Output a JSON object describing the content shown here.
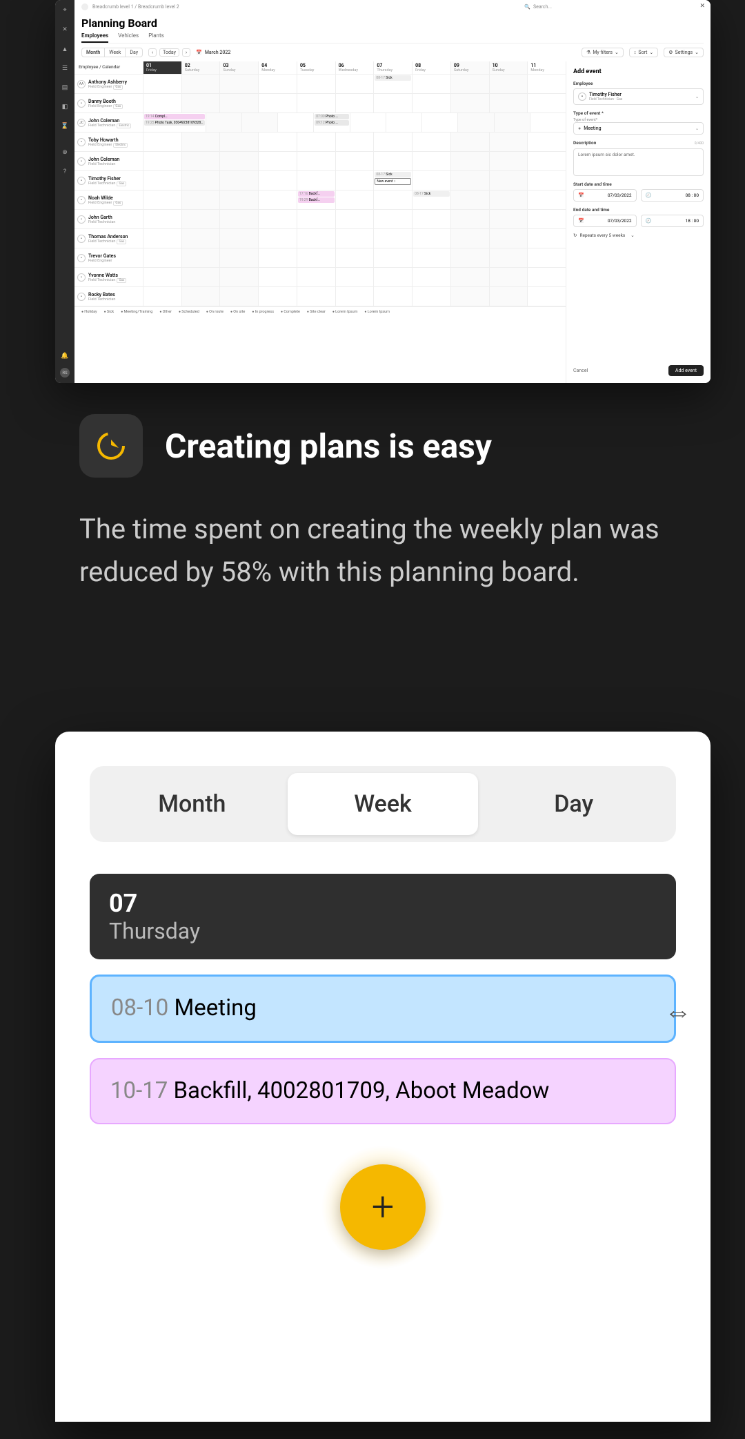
{
  "breadcrumbs": "Breadcrumb level 1 / Breadcrumb level 2",
  "searchPlaceholder": "Search...",
  "pageTitle": "Planning Board",
  "tabs": [
    "Employees",
    "Vehicles",
    "Plants"
  ],
  "activeTab": "Employees",
  "viewSeg": [
    "Month",
    "Week",
    "Day"
  ],
  "topSegActive": "Month",
  "todayLabel": "Today",
  "monthLabel": "March 2022",
  "toolbarRight": {
    "filters": "My filters",
    "sort": "Sort",
    "settings": "Settings"
  },
  "calHeaderLabel": "Employee / Calendar",
  "days": [
    {
      "num": "01",
      "name": "Friday",
      "sel": true
    },
    {
      "num": "02",
      "name": "Saturday",
      "wknd": true
    },
    {
      "num": "03",
      "name": "Sunday",
      "wknd": true
    },
    {
      "num": "04",
      "name": "Monday"
    },
    {
      "num": "05",
      "name": "Tuesday"
    },
    {
      "num": "06",
      "name": "Wednesday"
    },
    {
      "num": "07",
      "name": "Thursday"
    },
    {
      "num": "08",
      "name": "Friday"
    },
    {
      "num": "09",
      "name": "Saturday",
      "wknd": true
    },
    {
      "num": "10",
      "name": "Sunday",
      "wknd": true
    },
    {
      "num": "11",
      "name": "Monday"
    }
  ],
  "employees": [
    {
      "av": "AA",
      "name": "Anthony Ashberry",
      "role": "Field Engineer",
      "tag": "Gas",
      "events": [
        {
          "day": 6,
          "cls": "sick",
          "time": "08-17",
          "label": "Sick"
        }
      ]
    },
    {
      "av": "⚬",
      "name": "Danny Booth",
      "role": "Field Engineer",
      "tag": "Gas",
      "events": []
    },
    {
      "av": "JC",
      "name": "John Coleman",
      "role": "Field Technician",
      "tag": "Electric",
      "events": [
        {
          "day": 0,
          "cls": "pink",
          "time": "19:14",
          "label": "Compl…"
        },
        {
          "day": 0,
          "cls": "photo",
          "time": "19:25",
          "label": "Photo Task, 03049238109328…"
        },
        {
          "day": 4,
          "cls": "photo",
          "time": "07:00",
          "label": "Photo …"
        },
        {
          "day": 4,
          "cls": "photo",
          "time": "09:12",
          "label": "Photo …"
        }
      ]
    },
    {
      "av": "⚬",
      "name": "Toby Howarth",
      "role": "Field Engineer",
      "tag": "Electric",
      "events": []
    },
    {
      "av": "⚬",
      "name": "John Coleman",
      "role": "Field Technician",
      "tag": "",
      "events": []
    },
    {
      "av": "⚬",
      "name": "Timothy Fisher",
      "role": "Field Technician",
      "tag": "Gas",
      "events": [
        {
          "day": 6,
          "cls": "sick",
          "time": "08-17",
          "label": "Sick"
        },
        {
          "day": 6,
          "cls": "sel-box",
          "time": "",
          "label": "New event       ↕"
        }
      ]
    },
    {
      "av": "⚬",
      "name": "Noah Wilde",
      "role": "Field Engineer",
      "tag": "Gas",
      "events": [
        {
          "day": 4,
          "cls": "pink",
          "time": "17:16",
          "label": "Backf…"
        },
        {
          "day": 4,
          "cls": "pink",
          "time": "19:29",
          "label": "Backf…"
        },
        {
          "day": 7,
          "cls": "sick",
          "time": "08-17",
          "label": "Sick"
        }
      ]
    },
    {
      "av": "⚬",
      "name": "John Garth",
      "role": "Field Technician",
      "tag": "",
      "events": []
    },
    {
      "av": "⚬",
      "name": "Thomas Anderson",
      "role": "Field Technician",
      "tag": "Gas",
      "events": []
    },
    {
      "av": "⚬",
      "name": "Trevor Gates",
      "role": "Field Engineer",
      "tag": "",
      "events": []
    },
    {
      "av": "⚬",
      "name": "Yvonne Watts",
      "role": "Field Technician",
      "tag": "Gas",
      "events": []
    },
    {
      "av": "⚬",
      "name": "Rocky Bates",
      "role": "Field Technician",
      "tag": "",
      "events": []
    }
  ],
  "legend": [
    "Holiday",
    "Sick",
    "Meeting/Training",
    "Other",
    "Scheduled",
    "On route",
    "On site",
    "In progress",
    "Complete",
    "Site clear",
    "Lorem Ipsum",
    "Lorem Ipsum"
  ],
  "panel": {
    "title": "Add event",
    "employeeLabel": "Employee",
    "employeeName": "Timothy Fisher",
    "employeeRole": "Field Technician",
    "employeeTag": "Gas",
    "typeLabel": "Type of event *",
    "typeSub": "Type of event*",
    "typeValue": "Meeting",
    "descLabel": "Description",
    "descCount": "0/400",
    "descValue": "Lorem ipsum sic dolor amet.",
    "startLabel": "Start date and time",
    "startDate": "07/03/2022",
    "startTime": "08 : 00",
    "endLabel": "End date and time",
    "endDate": "07/03/2022",
    "endTime": "18 : 00",
    "repeat": "Repeats every 5 weeks",
    "cancel": "Cancel",
    "add": "Add event"
  },
  "feature": {
    "title": "Creating plans is easy",
    "body": "The time spent on creating the weekly plan was reduced by 58% with this planning board."
  },
  "mobile": {
    "segActive": "Week",
    "dayNum": "07",
    "dayName": "Thursday",
    "events": [
      {
        "cls": "blue",
        "time": "08-10",
        "label": "Meeting",
        "drag": true
      },
      {
        "cls": "pink",
        "time": "10-17",
        "label": "Backfill, 4002801709, Aboot Meadow"
      }
    ]
  }
}
